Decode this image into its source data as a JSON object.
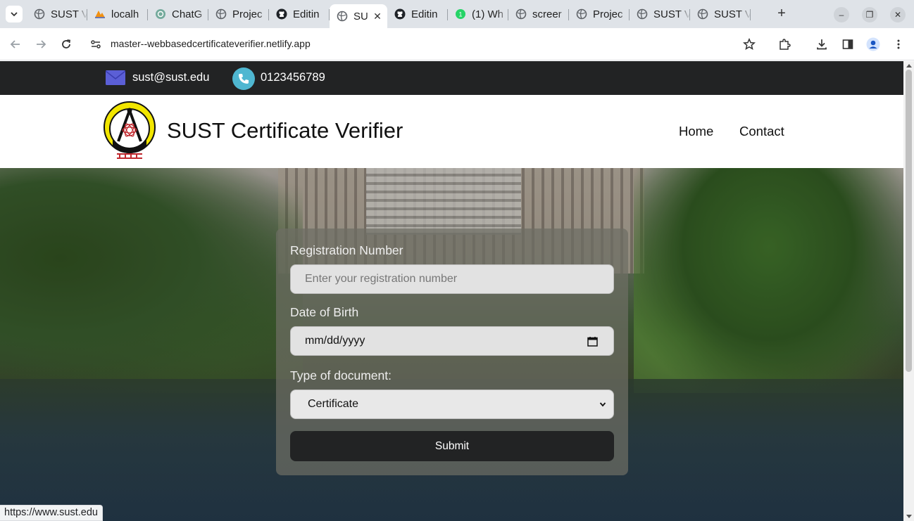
{
  "browser": {
    "tabs": [
      {
        "title": "SUST V",
        "favicon": "globe-icon",
        "active": false
      },
      {
        "title": "localh",
        "favicon": "phpmyadmin-icon",
        "active": false
      },
      {
        "title": "ChatG",
        "favicon": "chatgpt-icon",
        "active": false
      },
      {
        "title": "Projec",
        "favicon": "globe-icon",
        "active": false
      },
      {
        "title": "Editin",
        "favicon": "github-icon",
        "active": false
      },
      {
        "title": "SU",
        "favicon": "globe-icon",
        "active": true
      },
      {
        "title": "Editin",
        "favicon": "github-icon",
        "active": false
      },
      {
        "title": "(1) Wh",
        "favicon": "whatsapp-icon",
        "active": false
      },
      {
        "title": "screer",
        "favicon": "globe-icon",
        "active": false
      },
      {
        "title": "Projec",
        "favicon": "globe-icon",
        "active": false
      },
      {
        "title": "SUST V",
        "favicon": "globe-icon",
        "active": false
      },
      {
        "title": "SUST V",
        "favicon": "globe-icon",
        "active": false
      }
    ],
    "url": "master--webbasedcertificateverifier.netlify.app",
    "status_url": "https://www.sust.edu"
  },
  "topbar": {
    "email": "sust@sust.edu",
    "phone": "0123456789"
  },
  "header": {
    "site_title": "SUST Certificate Verifier",
    "nav": [
      {
        "label": "Home"
      },
      {
        "label": "Contact"
      }
    ]
  },
  "form": {
    "reg_label": "Registration Number",
    "reg_placeholder": "Enter your registration number",
    "dob_label": "Date of Birth",
    "dob_placeholder": "mm/dd/yyyy",
    "doctype_label": "Type of document:",
    "doctype_selected": "Certificate",
    "submit_label": "Submit"
  },
  "colors": {
    "topbar_bg": "#222324",
    "submit_bg": "#222324",
    "phone_icon_bg": "#4fb7d1",
    "mail_icon": "#5b5fd6"
  }
}
